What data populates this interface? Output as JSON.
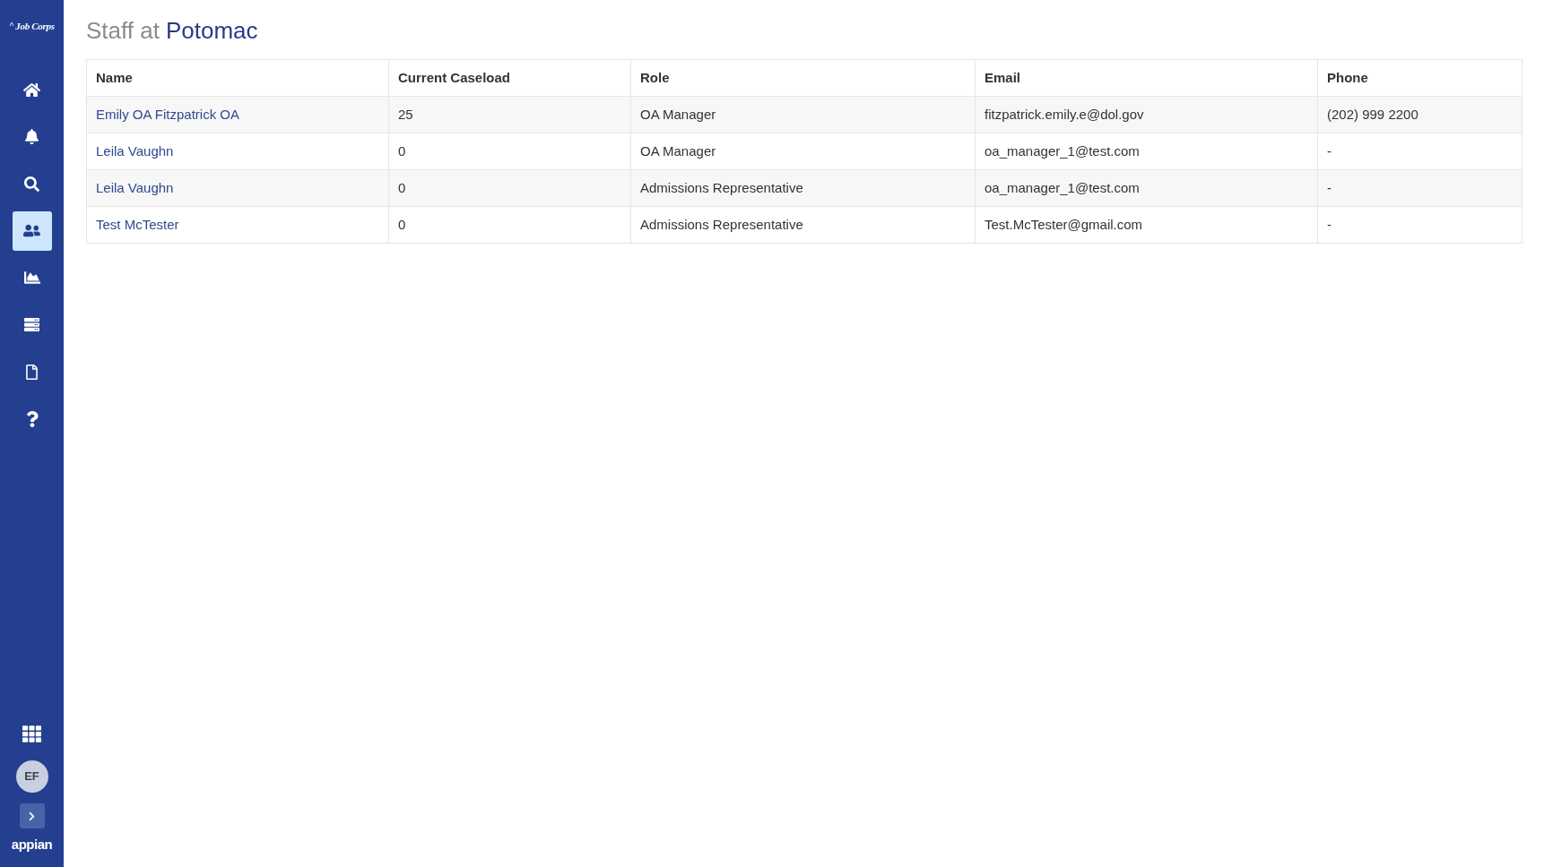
{
  "sidebar": {
    "logo": "Job Corps",
    "nav_items": [
      {
        "kind": "home",
        "selected": false
      },
      {
        "kind": "notifications",
        "selected": false
      },
      {
        "kind": "search",
        "selected": false
      },
      {
        "kind": "people",
        "selected": true
      },
      {
        "kind": "reports",
        "selected": false
      },
      {
        "kind": "records",
        "selected": false
      },
      {
        "kind": "documents",
        "selected": false
      },
      {
        "kind": "help",
        "selected": false
      }
    ],
    "avatar_initials": "EF",
    "brand": "appian"
  },
  "title": {
    "prefix": "Staff at",
    "location": "Potomac"
  },
  "table": {
    "columns": [
      "Name",
      "Current Caseload",
      "Role",
      "Email",
      "Phone"
    ],
    "rows": [
      {
        "cells": [
          "Emily OA Fitzpatrick OA",
          "25",
          "OA Manager",
          "fitzpatrick.emily.e@dol.gov",
          "(202) 999 2200"
        ]
      },
      {
        "cells": [
          "Leila Vaughn",
          "0",
          "OA Manager",
          "oa_manager_1@test.com",
          "-"
        ]
      },
      {
        "cells": [
          "Leila Vaughn",
          "0",
          "Admissions Representative",
          "oa_manager_1@test.com",
          "-"
        ]
      },
      {
        "cells": [
          "Test McTester",
          "0",
          "Admissions Representative",
          "Test.McTester@gmail.com",
          "-"
        ]
      }
    ]
  }
}
